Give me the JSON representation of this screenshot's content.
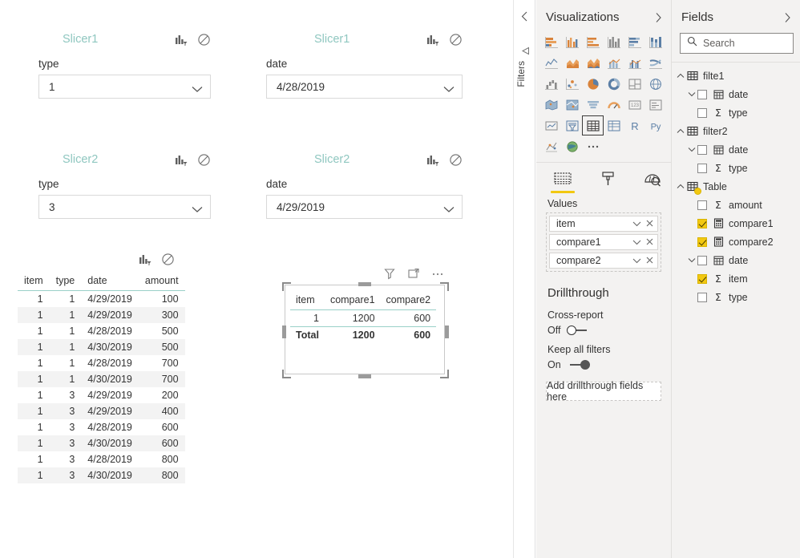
{
  "canvas": {
    "slicers": [
      {
        "title": "Slicer1",
        "field_label": "type",
        "value": "1"
      },
      {
        "title": "Slicer1",
        "field_label": "date",
        "value": "4/28/2019"
      },
      {
        "title": "Slicer2",
        "field_label": "type",
        "value": "3"
      },
      {
        "title": "Slicer2",
        "field_label": "date",
        "value": "4/29/2019"
      }
    ],
    "data_table": {
      "columns": [
        "item",
        "type",
        "date",
        "amount"
      ],
      "rows": [
        [
          "1",
          "1",
          "4/29/2019",
          "100"
        ],
        [
          "1",
          "1",
          "4/29/2019",
          "300"
        ],
        [
          "1",
          "1",
          "4/28/2019",
          "500"
        ],
        [
          "1",
          "1",
          "4/30/2019",
          "500"
        ],
        [
          "1",
          "1",
          "4/28/2019",
          "700"
        ],
        [
          "1",
          "1",
          "4/30/2019",
          "700"
        ],
        [
          "1",
          "3",
          "4/29/2019",
          "200"
        ],
        [
          "1",
          "3",
          "4/29/2019",
          "400"
        ],
        [
          "1",
          "3",
          "4/28/2019",
          "600"
        ],
        [
          "1",
          "3",
          "4/30/2019",
          "600"
        ],
        [
          "1",
          "3",
          "4/28/2019",
          "800"
        ],
        [
          "1",
          "3",
          "4/30/2019",
          "800"
        ]
      ]
    },
    "matrix_table": {
      "columns": [
        "item",
        "compare1",
        "compare2"
      ],
      "rows": [
        [
          "1",
          "1200",
          "600"
        ]
      ],
      "total_row": [
        "Total",
        "1200",
        "600"
      ]
    }
  },
  "filters_rail": {
    "label": "Filters"
  },
  "visualizations": {
    "title": "Visualizations",
    "selected_visual": "table",
    "tabs": [
      {
        "name": "fields",
        "active": true
      },
      {
        "name": "format",
        "active": false
      },
      {
        "name": "analytics",
        "active": false
      }
    ],
    "values_label": "Values",
    "values": [
      "item",
      "compare1",
      "compare2"
    ],
    "drillthrough": {
      "title": "Drillthrough",
      "cross_report_label": "Cross-report",
      "cross_report_state": "Off",
      "keep_filters_label": "Keep all filters",
      "keep_filters_state": "On",
      "drop_placeholder": "Add drillthrough fields here"
    }
  },
  "fields": {
    "title": "Fields",
    "search_placeholder": "Search",
    "tables": [
      {
        "name": "filte1",
        "expanded": true,
        "fields": [
          {
            "name": "date",
            "icon": "calendar",
            "checked": false,
            "expandable": true
          },
          {
            "name": "type",
            "icon": "sigma",
            "checked": false,
            "expandable": false
          }
        ]
      },
      {
        "name": "filter2",
        "expanded": true,
        "fields": [
          {
            "name": "date",
            "icon": "calendar",
            "checked": false,
            "expandable": true
          },
          {
            "name": "type",
            "icon": "sigma",
            "checked": false,
            "expandable": false
          }
        ]
      },
      {
        "name": "Table",
        "expanded": true,
        "highlighted": true,
        "fields": [
          {
            "name": "amount",
            "icon": "sigma",
            "checked": false,
            "expandable": false
          },
          {
            "name": "compare1",
            "icon": "measure",
            "checked": true,
            "expandable": false
          },
          {
            "name": "compare2",
            "icon": "measure",
            "checked": true,
            "expandable": false
          },
          {
            "name": "date",
            "icon": "calendar",
            "checked": false,
            "expandable": true
          },
          {
            "name": "item",
            "icon": "sigma",
            "checked": true,
            "expandable": false
          },
          {
            "name": "type",
            "icon": "sigma",
            "checked": false,
            "expandable": false
          }
        ]
      }
    ]
  },
  "colors": {
    "accent_teal": "#9ad0c8",
    "title_teal": "#8fc7c0",
    "panel_bg": "#f3f2f1",
    "check_yellow": "#f2c811"
  }
}
